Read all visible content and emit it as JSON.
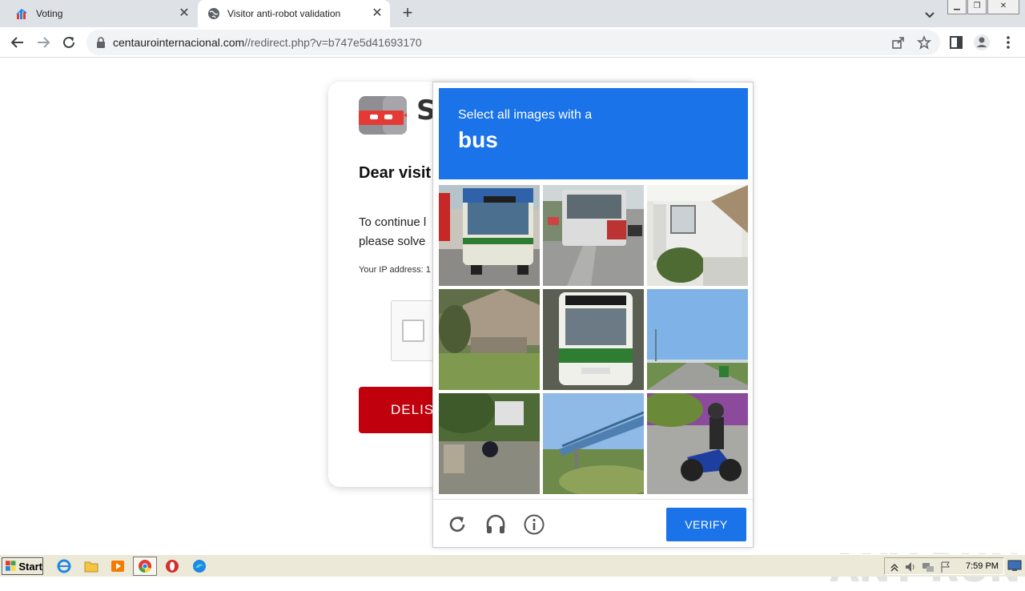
{
  "browser": {
    "tabs": [
      {
        "title": "Voting",
        "icon": "voting-favicon-icon"
      },
      {
        "title": "Visitor anti-robot validation",
        "icon": "globe-icon"
      }
    ],
    "url_domain": "centaurointernacional.com",
    "url_path": "//redirect.php?v=b747e5d41693170"
  },
  "page": {
    "brand_partial": "S",
    "greeting": "Dear visit",
    "body_line1": "To continue l",
    "body_line2": "please solve",
    "ip_label": "Your IP address: 1",
    "button_label": "DELIS"
  },
  "captcha": {
    "prompt": "Select all images with a",
    "target": "bus",
    "verify_label": "VERIFY",
    "tiles": [
      {
        "subject": "bus-front"
      },
      {
        "subject": "bus-road"
      },
      {
        "subject": "house-porch"
      },
      {
        "subject": "house-yard"
      },
      {
        "subject": "bus-front-green"
      },
      {
        "subject": "highway-sky"
      },
      {
        "subject": "park-motorbike"
      },
      {
        "subject": "bridge"
      },
      {
        "subject": "motorcycle-rider"
      }
    ],
    "accent_color": "#1a73e8"
  },
  "watermark": "ANY RUN",
  "taskbar": {
    "start_label": "Start",
    "apps": [
      "ie-icon",
      "folder-icon",
      "media-player-icon",
      "chrome-icon",
      "opera-icon",
      "edge-icon"
    ],
    "clock": "7:59 PM"
  }
}
